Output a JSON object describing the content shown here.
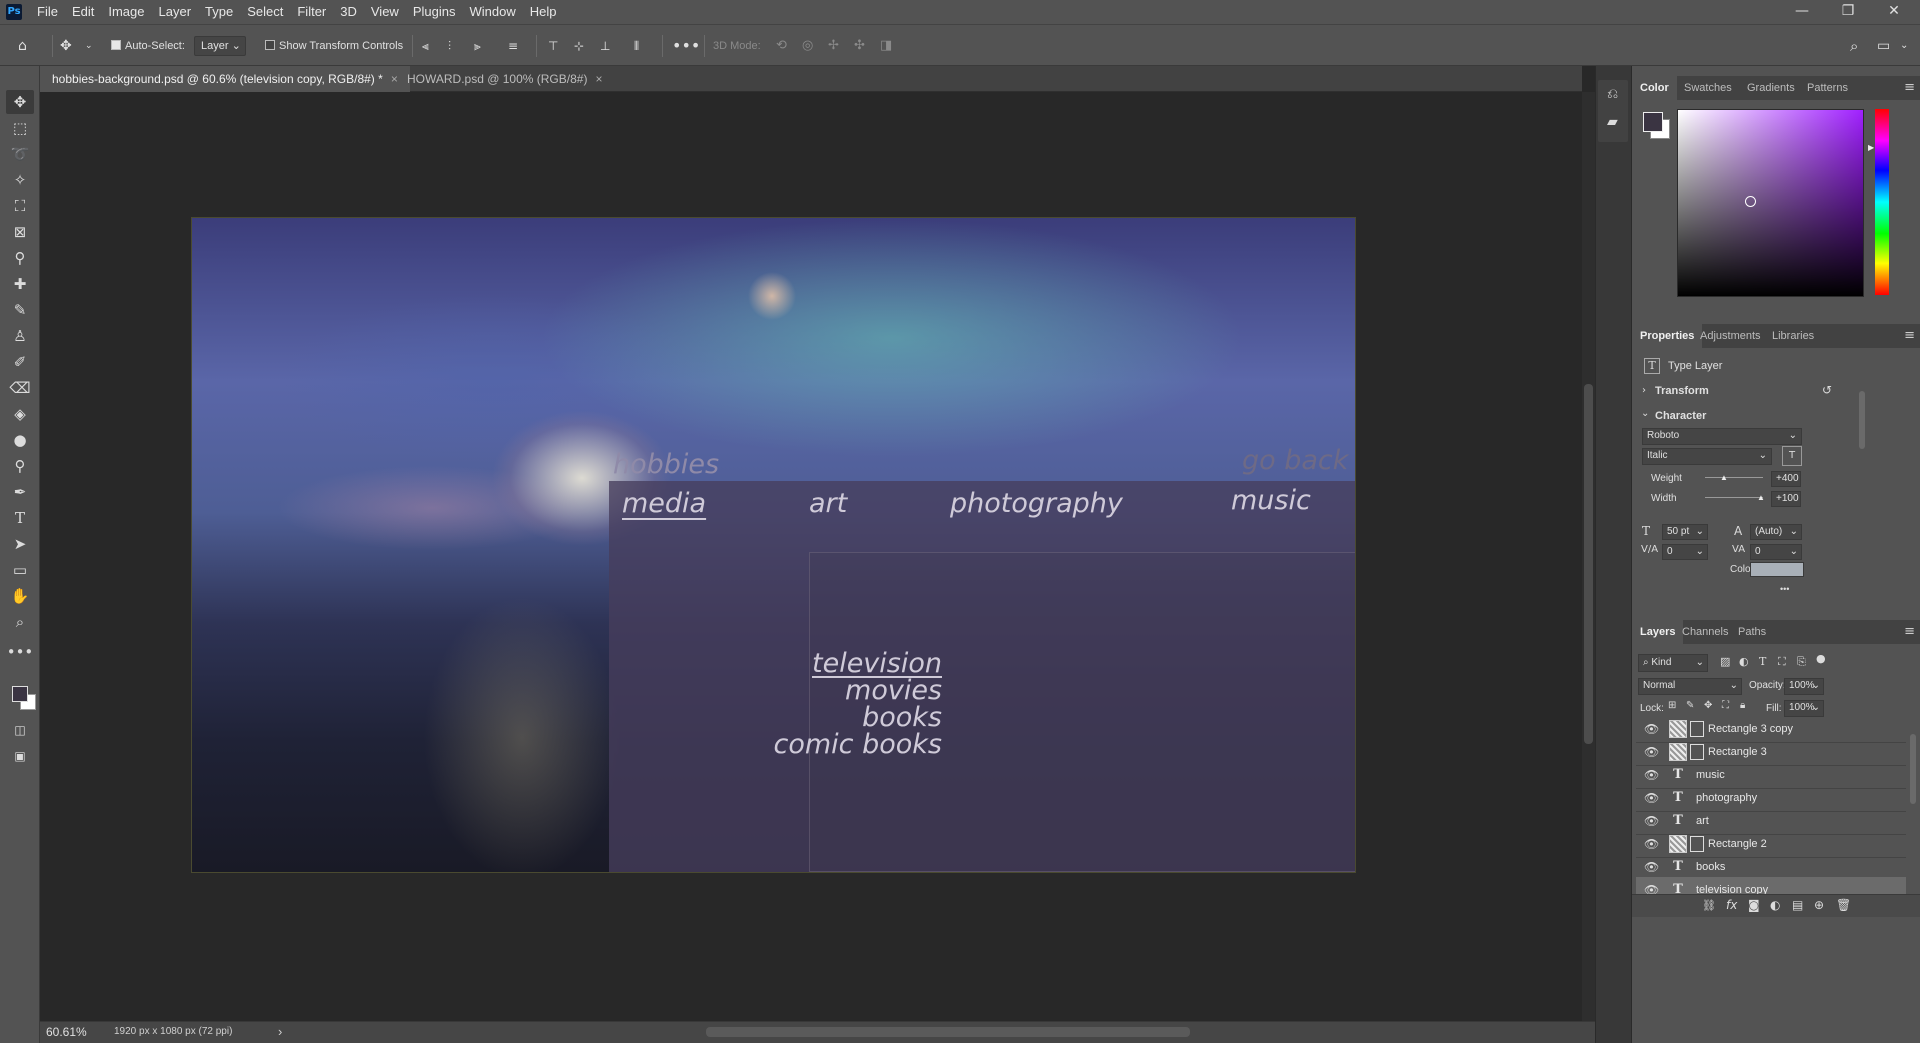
{
  "app": {
    "logo": "Ps"
  },
  "menu": [
    "File",
    "Edit",
    "Image",
    "Layer",
    "Type",
    "Select",
    "Filter",
    "3D",
    "View",
    "Plugins",
    "Window",
    "Help"
  ],
  "window_controls": {
    "minimize": "—",
    "restore": "❐",
    "close": "✕"
  },
  "options": {
    "auto_select_label": "Auto-Select:",
    "auto_select_value": "Layer",
    "show_transform_label": "Show Transform Controls",
    "mode_3d_label": "3D Mode:"
  },
  "tabs": [
    {
      "label": "hobbies-background.psd @ 60.6% (television copy, RGB/8#) *",
      "active": true
    },
    {
      "label": "HOWARD.psd @ 100% (RGB/8#)",
      "active": false
    }
  ],
  "canvas": {
    "hobbies": "hobbies",
    "go_back": "go back",
    "nav": [
      "media",
      "art",
      "photography",
      "music"
    ],
    "submenu": [
      "television",
      "movies",
      "books",
      "comic books"
    ]
  },
  "status": {
    "zoom": "60.61%",
    "doc_info": "1920 px x 1080 px (72 ppi)",
    "arrow": "›"
  },
  "color_panel": {
    "tabs": [
      "Color",
      "Swatches",
      "Gradients",
      "Patterns"
    ],
    "foreground": "#3a3442",
    "background": "#ffffff",
    "hue_base": "#a020ff"
  },
  "properties_panel": {
    "tabs": [
      "Properties",
      "Adjustments",
      "Libraries"
    ],
    "layer_type": "Type Layer",
    "section_transform": "Transform",
    "section_character": "Character",
    "font_family": "Roboto",
    "font_style": "Italic",
    "weight_label": "Weight",
    "weight_value": "+400",
    "width_label": "Width",
    "width_value": "+100",
    "size_value": "50 pt",
    "leading_value": "(Auto)",
    "kerning_value": "0",
    "tracking_value": "0",
    "color_label": "Color",
    "text_color": "#a9b0b8",
    "more": "•••"
  },
  "layers_panel": {
    "tabs": [
      "Layers",
      "Channels",
      "Paths"
    ],
    "filter_label": "Kind",
    "blend_mode": "Normal",
    "opacity_label": "Opacity:",
    "opacity_value": "100%",
    "lock_label": "Lock:",
    "fill_label": "Fill:",
    "fill_value": "100%",
    "layers": [
      {
        "name": "Rectangle 3 copy",
        "type": "rect"
      },
      {
        "name": "Rectangle 3",
        "type": "rect"
      },
      {
        "name": "music",
        "type": "text"
      },
      {
        "name": "photography",
        "type": "text"
      },
      {
        "name": "art",
        "type": "text"
      },
      {
        "name": "Rectangle 2",
        "type": "rect"
      },
      {
        "name": "books",
        "type": "text"
      },
      {
        "name": "television copy",
        "type": "text",
        "selected": true
      }
    ]
  }
}
